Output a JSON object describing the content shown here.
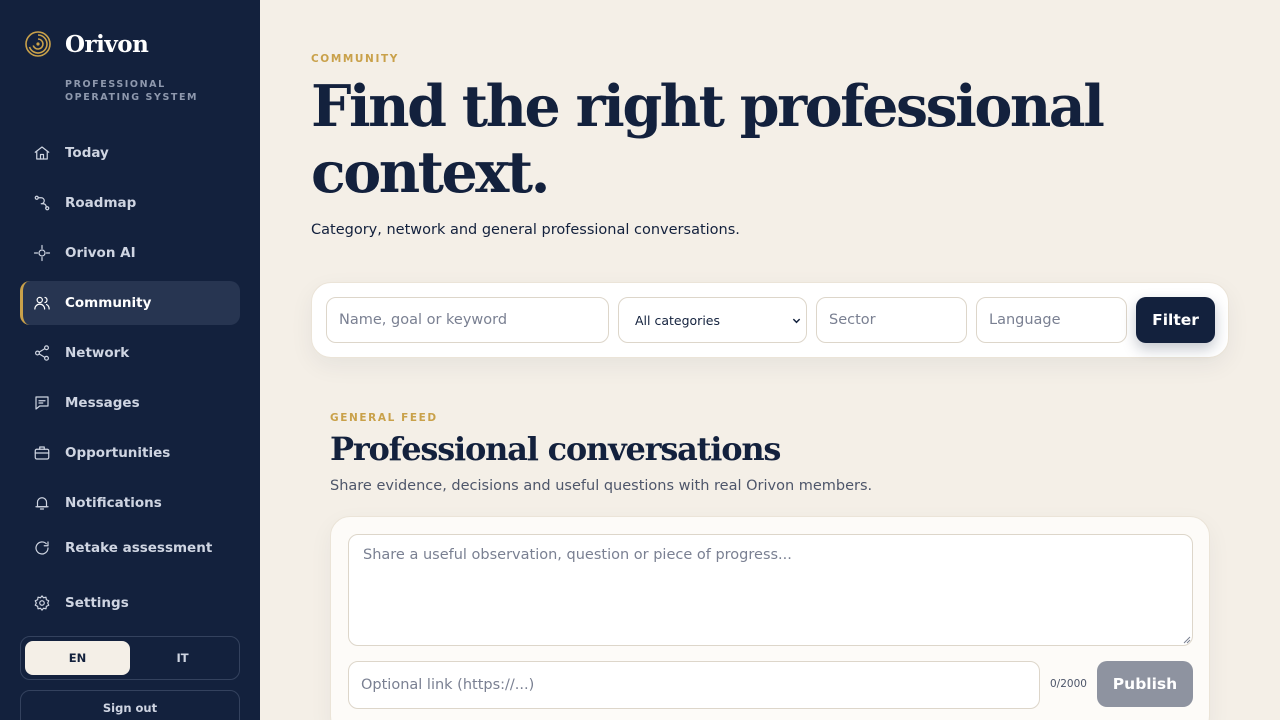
{
  "brand": {
    "name": "Orivon",
    "tagline": "PROFESSIONAL OPERATING SYSTEM",
    "accent": "#c9a14a"
  },
  "sidebar": {
    "background": "#13213d",
    "items": [
      {
        "label": "Today",
        "icon": "home-icon"
      },
      {
        "label": "Roadmap",
        "icon": "route-icon"
      },
      {
        "label": "Orivon AI",
        "icon": "sparkle-icon"
      },
      {
        "label": "Community",
        "icon": "users-icon",
        "active": true
      },
      {
        "label": "Network",
        "icon": "share-icon"
      },
      {
        "label": "Messages",
        "icon": "message-icon"
      },
      {
        "label": "Opportunities",
        "icon": "briefcase-icon"
      },
      {
        "label": "Notifications",
        "icon": "bell-icon"
      },
      {
        "label": "Retake assessment",
        "icon": "refresh-icon"
      },
      {
        "label": "Settings",
        "icon": "gear-icon"
      }
    ],
    "languages": [
      "EN",
      "IT"
    ],
    "selected_language": "EN",
    "signout_label": "Sign out"
  },
  "hero": {
    "eyebrow": "COMMUNITY",
    "title": "Find the right professional context.",
    "subtitle": "Category, network and general professional conversations."
  },
  "filters": {
    "search_placeholder": "Name, goal or keyword",
    "category_selected": "All categories",
    "sector_placeholder": "Sector",
    "language_placeholder": "Language",
    "filter_label": "Filter"
  },
  "feed": {
    "eyebrow": "GENERAL FEED",
    "title": "Professional conversations",
    "subtitle": "Share evidence, decisions and useful questions with real Orivon members.",
    "compose_placeholder": "Share a useful observation, question or piece of progress...",
    "link_placeholder": "Optional link (https://...)",
    "char_count": "0/2000",
    "publish_label": "Publish"
  }
}
